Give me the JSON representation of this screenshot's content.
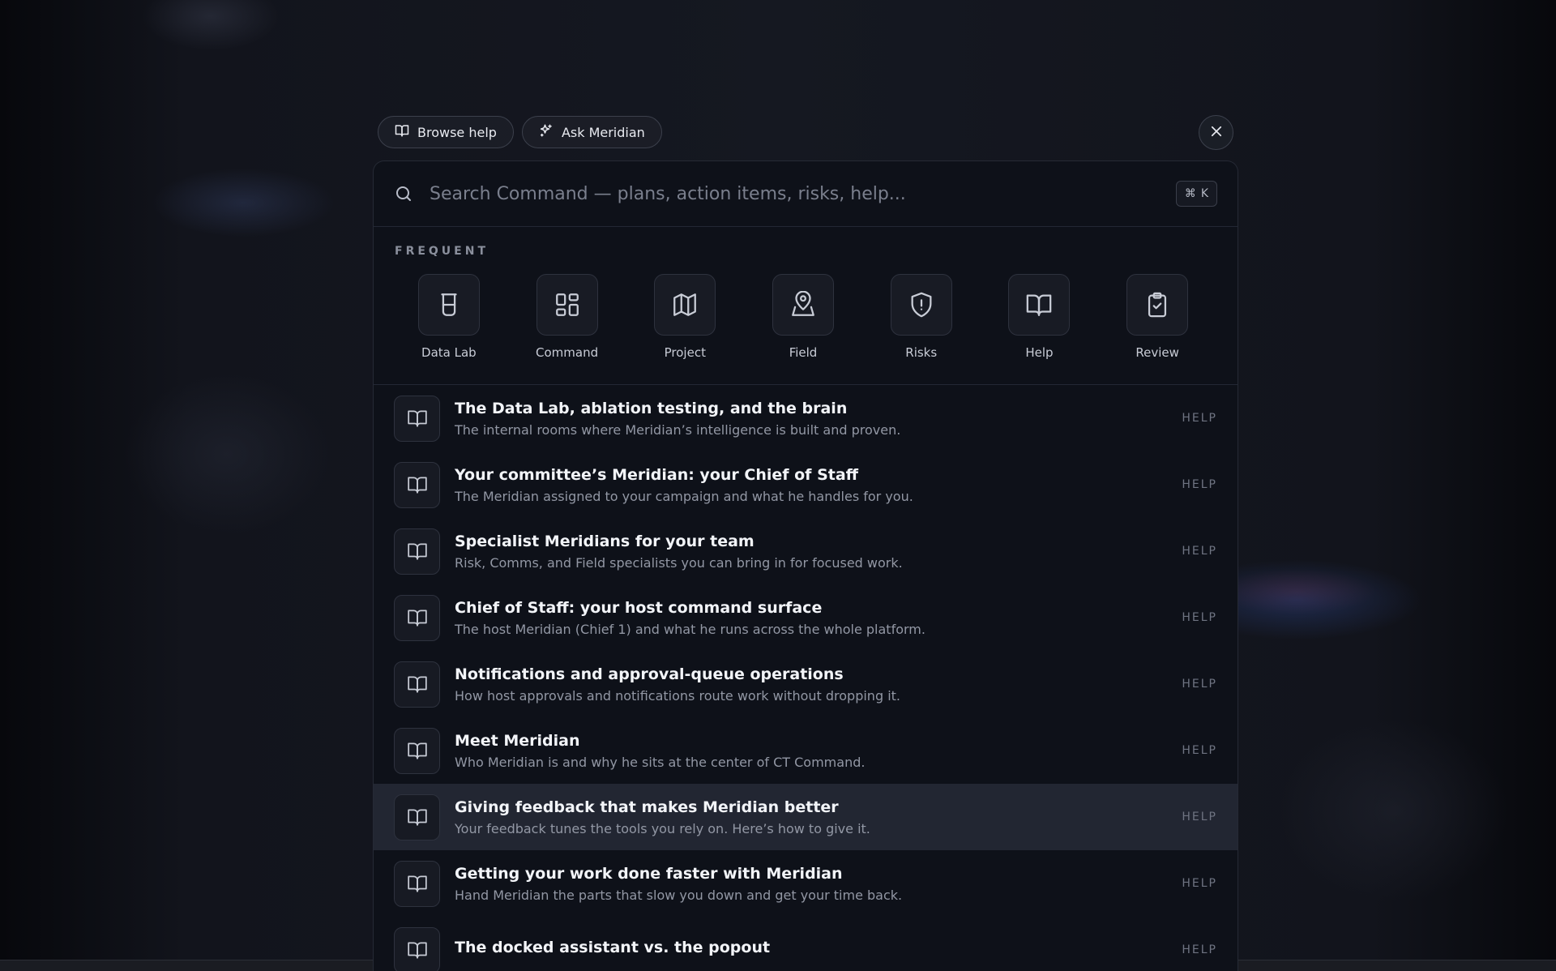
{
  "top_bar": {
    "browse_help_label": "Browse help",
    "ask_label": "Ask Meridian"
  },
  "search": {
    "placeholder": "Search Command — plans, action items, risks, help...",
    "value": "",
    "shortcut_symbol": "⌘",
    "shortcut_key": "K"
  },
  "frequent": {
    "label": "FREQUENT",
    "items": [
      {
        "label": "Data Lab",
        "icon": "beaker-icon"
      },
      {
        "label": "Command",
        "icon": "grid-icon"
      },
      {
        "label": "Project",
        "icon": "map-icon"
      },
      {
        "label": "Field",
        "icon": "map-pin-person-icon"
      },
      {
        "label": "Risks",
        "icon": "shield-alert-icon"
      },
      {
        "label": "Help",
        "icon": "book-icon"
      },
      {
        "label": "Review",
        "icon": "clipboard-check-icon"
      }
    ]
  },
  "results": [
    {
      "title": "The Data Lab, ablation testing, and the brain",
      "subtitle": "The internal rooms where Meridian’s intelligence is built and proven.",
      "tag": "HELP"
    },
    {
      "title": "Your committee’s Meridian: your Chief of Staff",
      "subtitle": "The Meridian assigned to your campaign and what he handles for you.",
      "tag": "HELP"
    },
    {
      "title": "Specialist Meridians for your team",
      "subtitle": "Risk, Comms, and Field specialists you can bring in for focused work.",
      "tag": "HELP"
    },
    {
      "title": "Chief of Staff: your host command surface",
      "subtitle": "The host Meridian (Chief 1) and what he runs across the whole platform.",
      "tag": "HELP"
    },
    {
      "title": "Notifications and approval-queue operations",
      "subtitle": "How host approvals and notifications route work without dropping it.",
      "tag": "HELP"
    },
    {
      "title": "Meet Meridian",
      "subtitle": "Who Meridian is and why he sits at the center of CT Command.",
      "tag": "HELP"
    },
    {
      "title": "Giving feedback that makes Meridian better",
      "subtitle": "Your feedback tunes the tools you rely on. Here’s how to give it.",
      "tag": "HELP"
    },
    {
      "title": "Getting your work done faster with Meridian",
      "subtitle": "Hand Meridian the parts that slow you down and get your time back.",
      "tag": "HELP"
    },
    {
      "title": "The docked assistant vs. the popout",
      "subtitle": "",
      "tag": "HELP"
    }
  ],
  "active_result_index": 6
}
